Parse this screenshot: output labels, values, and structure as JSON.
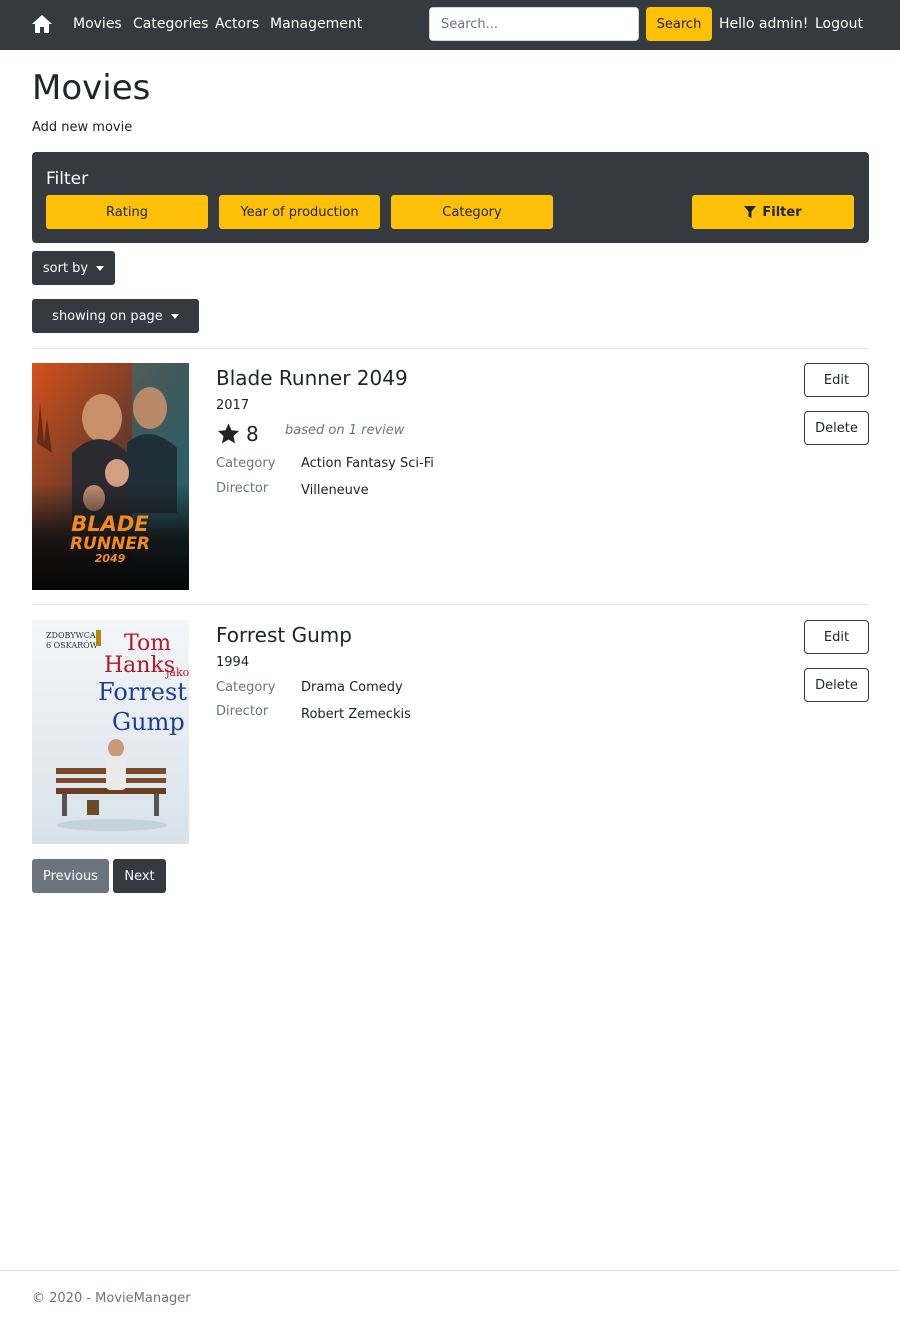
{
  "nav": {
    "links": [
      "Movies",
      "Categories",
      "Actors",
      "Management"
    ],
    "search_placeholder": "Search...",
    "search_button": "Search",
    "greeting": "Hello admin!",
    "logout": "Logout"
  },
  "page": {
    "title": "Movies",
    "add_link": "Add new movie"
  },
  "filter": {
    "title": "Filter",
    "buttons": [
      "Rating",
      "Year of production",
      "Category"
    ],
    "submit": "Filter"
  },
  "controls": {
    "sort": "sort by",
    "showing": "showing on page"
  },
  "movies": [
    {
      "title": "Blade Runner 2049",
      "year": "2017",
      "rating": "8",
      "rating_note": "based on 1 review",
      "category_label": "Category",
      "category": "Action Fantasy Sci-Fi",
      "director_label": "Director",
      "director": "Villeneuve",
      "edit": "Edit",
      "delete": "Delete",
      "poster_text": [
        "BLADE",
        "RUNNER",
        "2049"
      ]
    },
    {
      "title": "Forrest Gump",
      "year": "1994",
      "category_label": "Category",
      "category": "Drama Comedy",
      "director_label": "Director",
      "director": "Robert Zemeckis",
      "edit": "Edit",
      "delete": "Delete",
      "poster_text": [
        "ZDOBYWCA",
        "6 OSKARÓW",
        "Tom",
        "Hanks",
        "jako",
        "Forrest",
        "Gump"
      ]
    }
  ],
  "pagination": {
    "previous": "Previous",
    "next": "Next"
  },
  "footer": {
    "text": "© 2020 - MovieManager"
  },
  "colors": {
    "navbar": "#343a40",
    "accent": "#ffc107",
    "secondary": "#6c757d"
  }
}
